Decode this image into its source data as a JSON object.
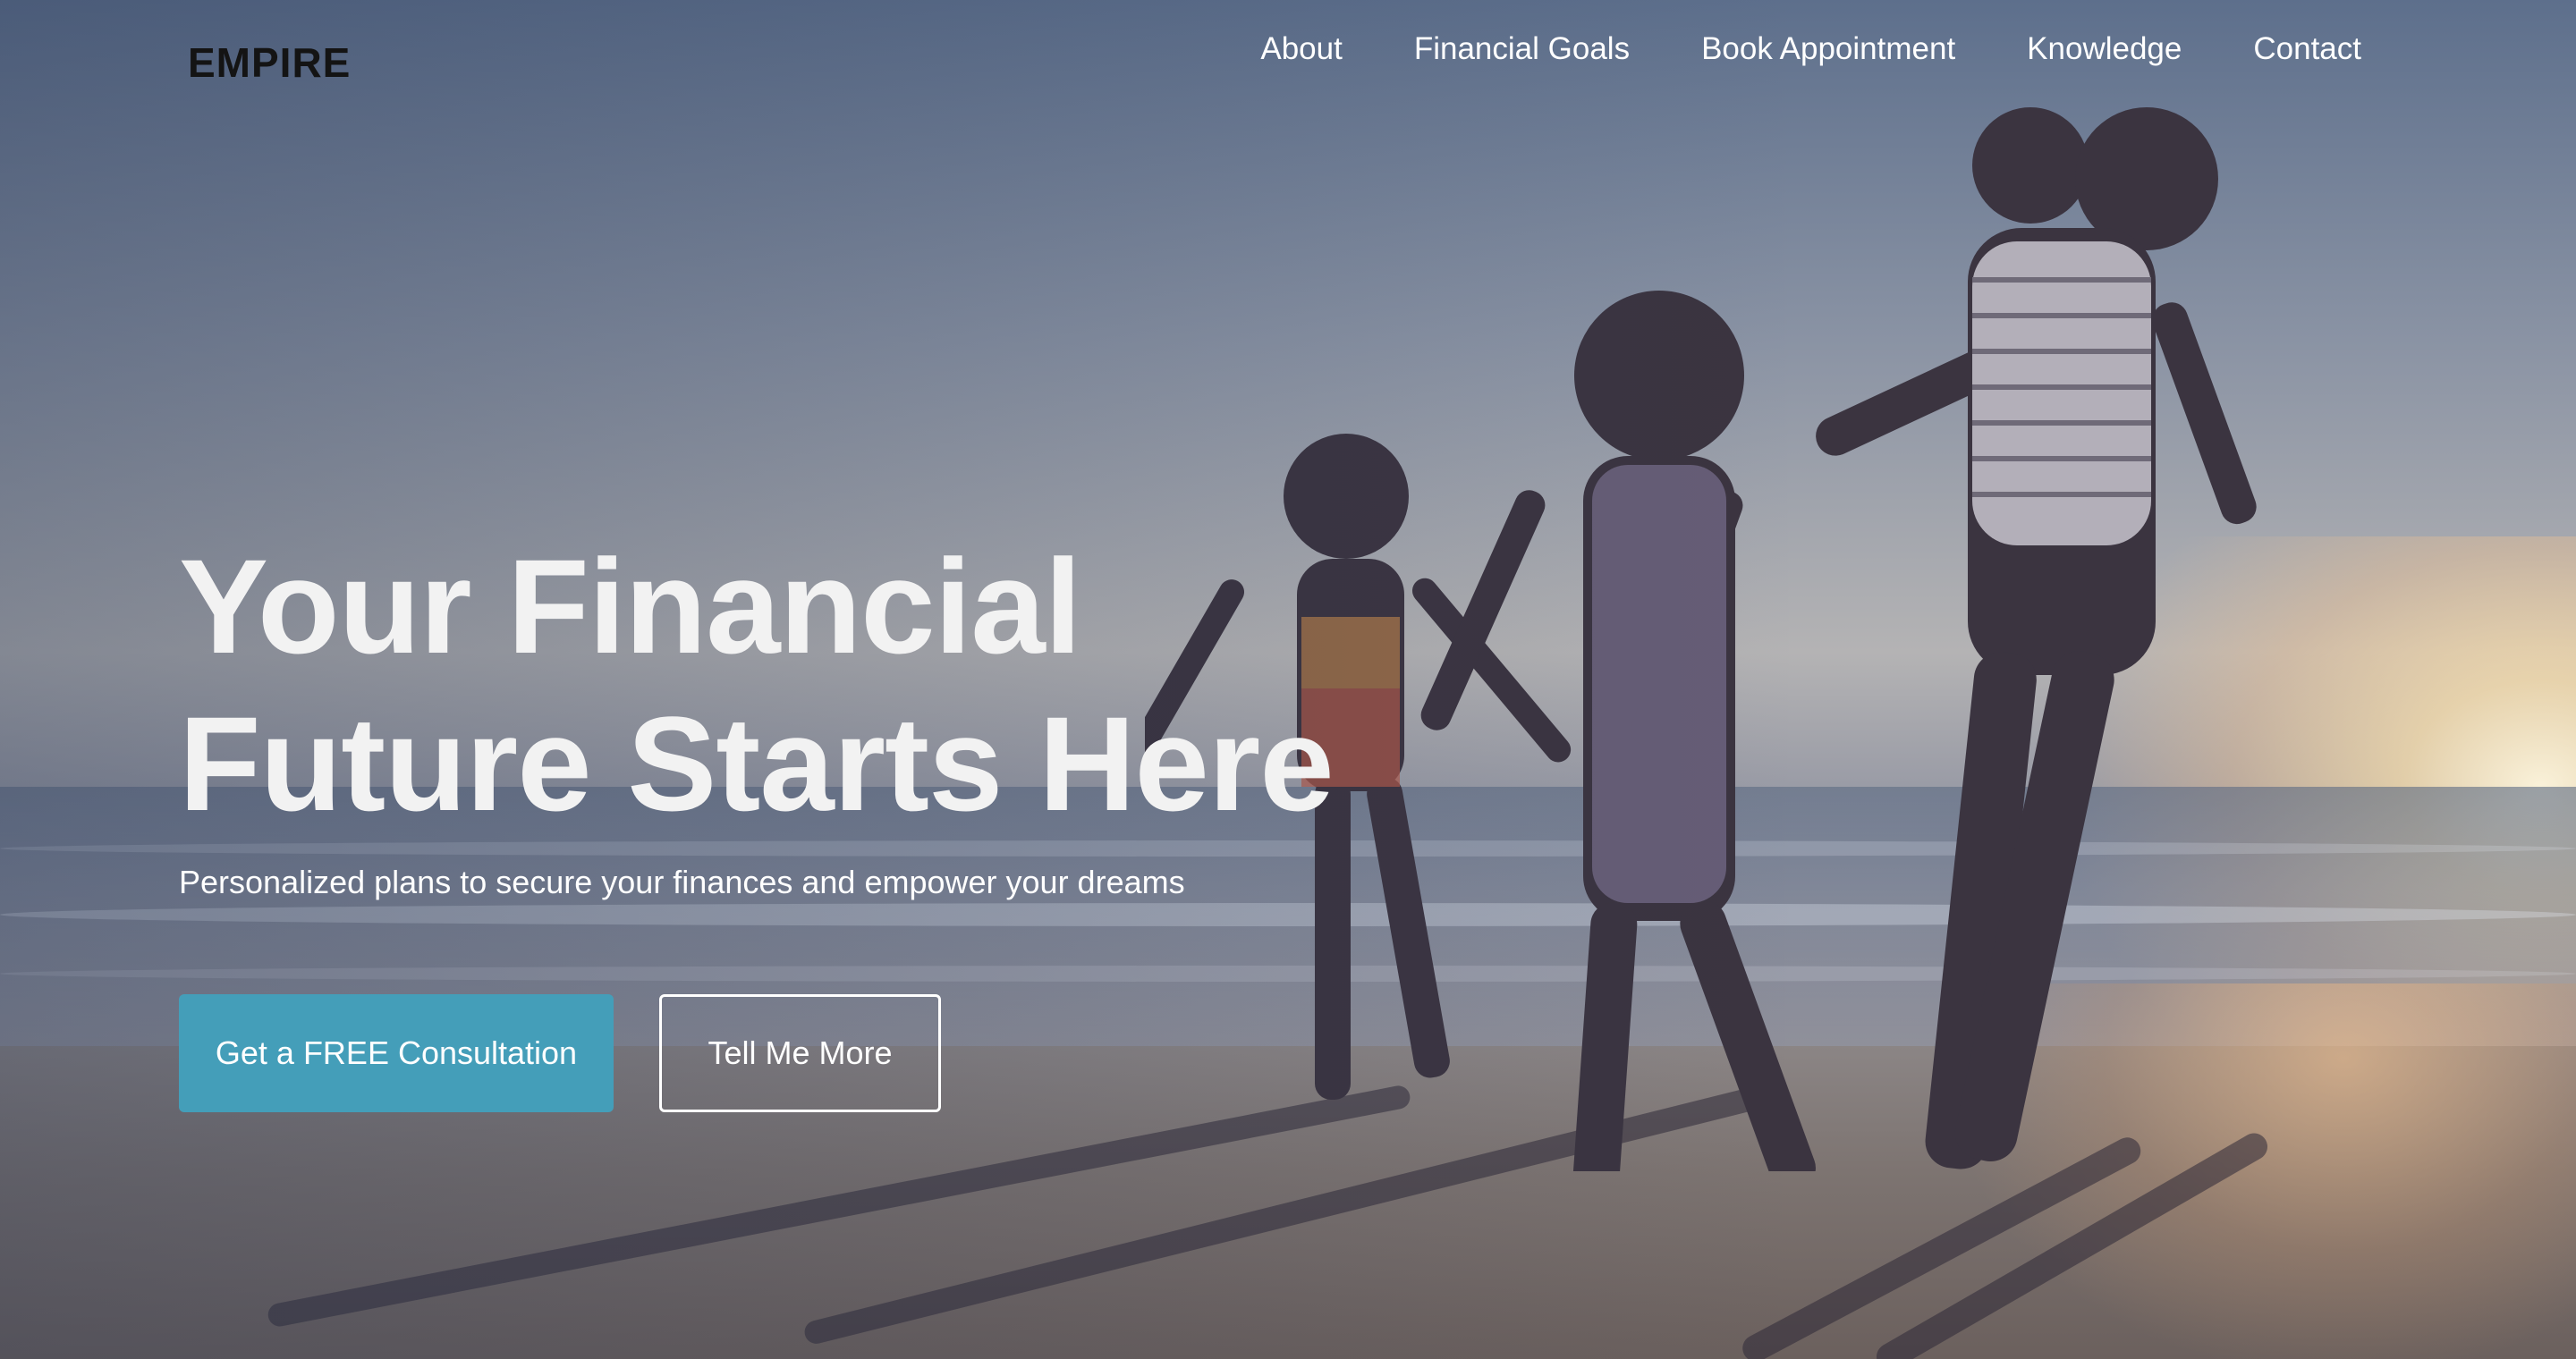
{
  "header": {
    "logo_text": "EMPIRE",
    "nav": [
      {
        "label": "About"
      },
      {
        "label": "Financial Goals"
      },
      {
        "label": "Book Appointment"
      },
      {
        "label": "Knowledge"
      },
      {
        "label": "Contact"
      }
    ]
  },
  "hero": {
    "headline_line1": "Your Financial",
    "headline_line2": "Future Starts Here",
    "subtitle": "Personalized plans to secure your finances and empower your dreams",
    "primary_cta": "Get a FREE Consultation",
    "secondary_cta": "Tell Me More",
    "image": "family-walking-on-beach-at-sunset"
  },
  "colors": {
    "accent": "#449eb9",
    "text": "#ffffff",
    "logo_gold": "#c9b23a"
  }
}
